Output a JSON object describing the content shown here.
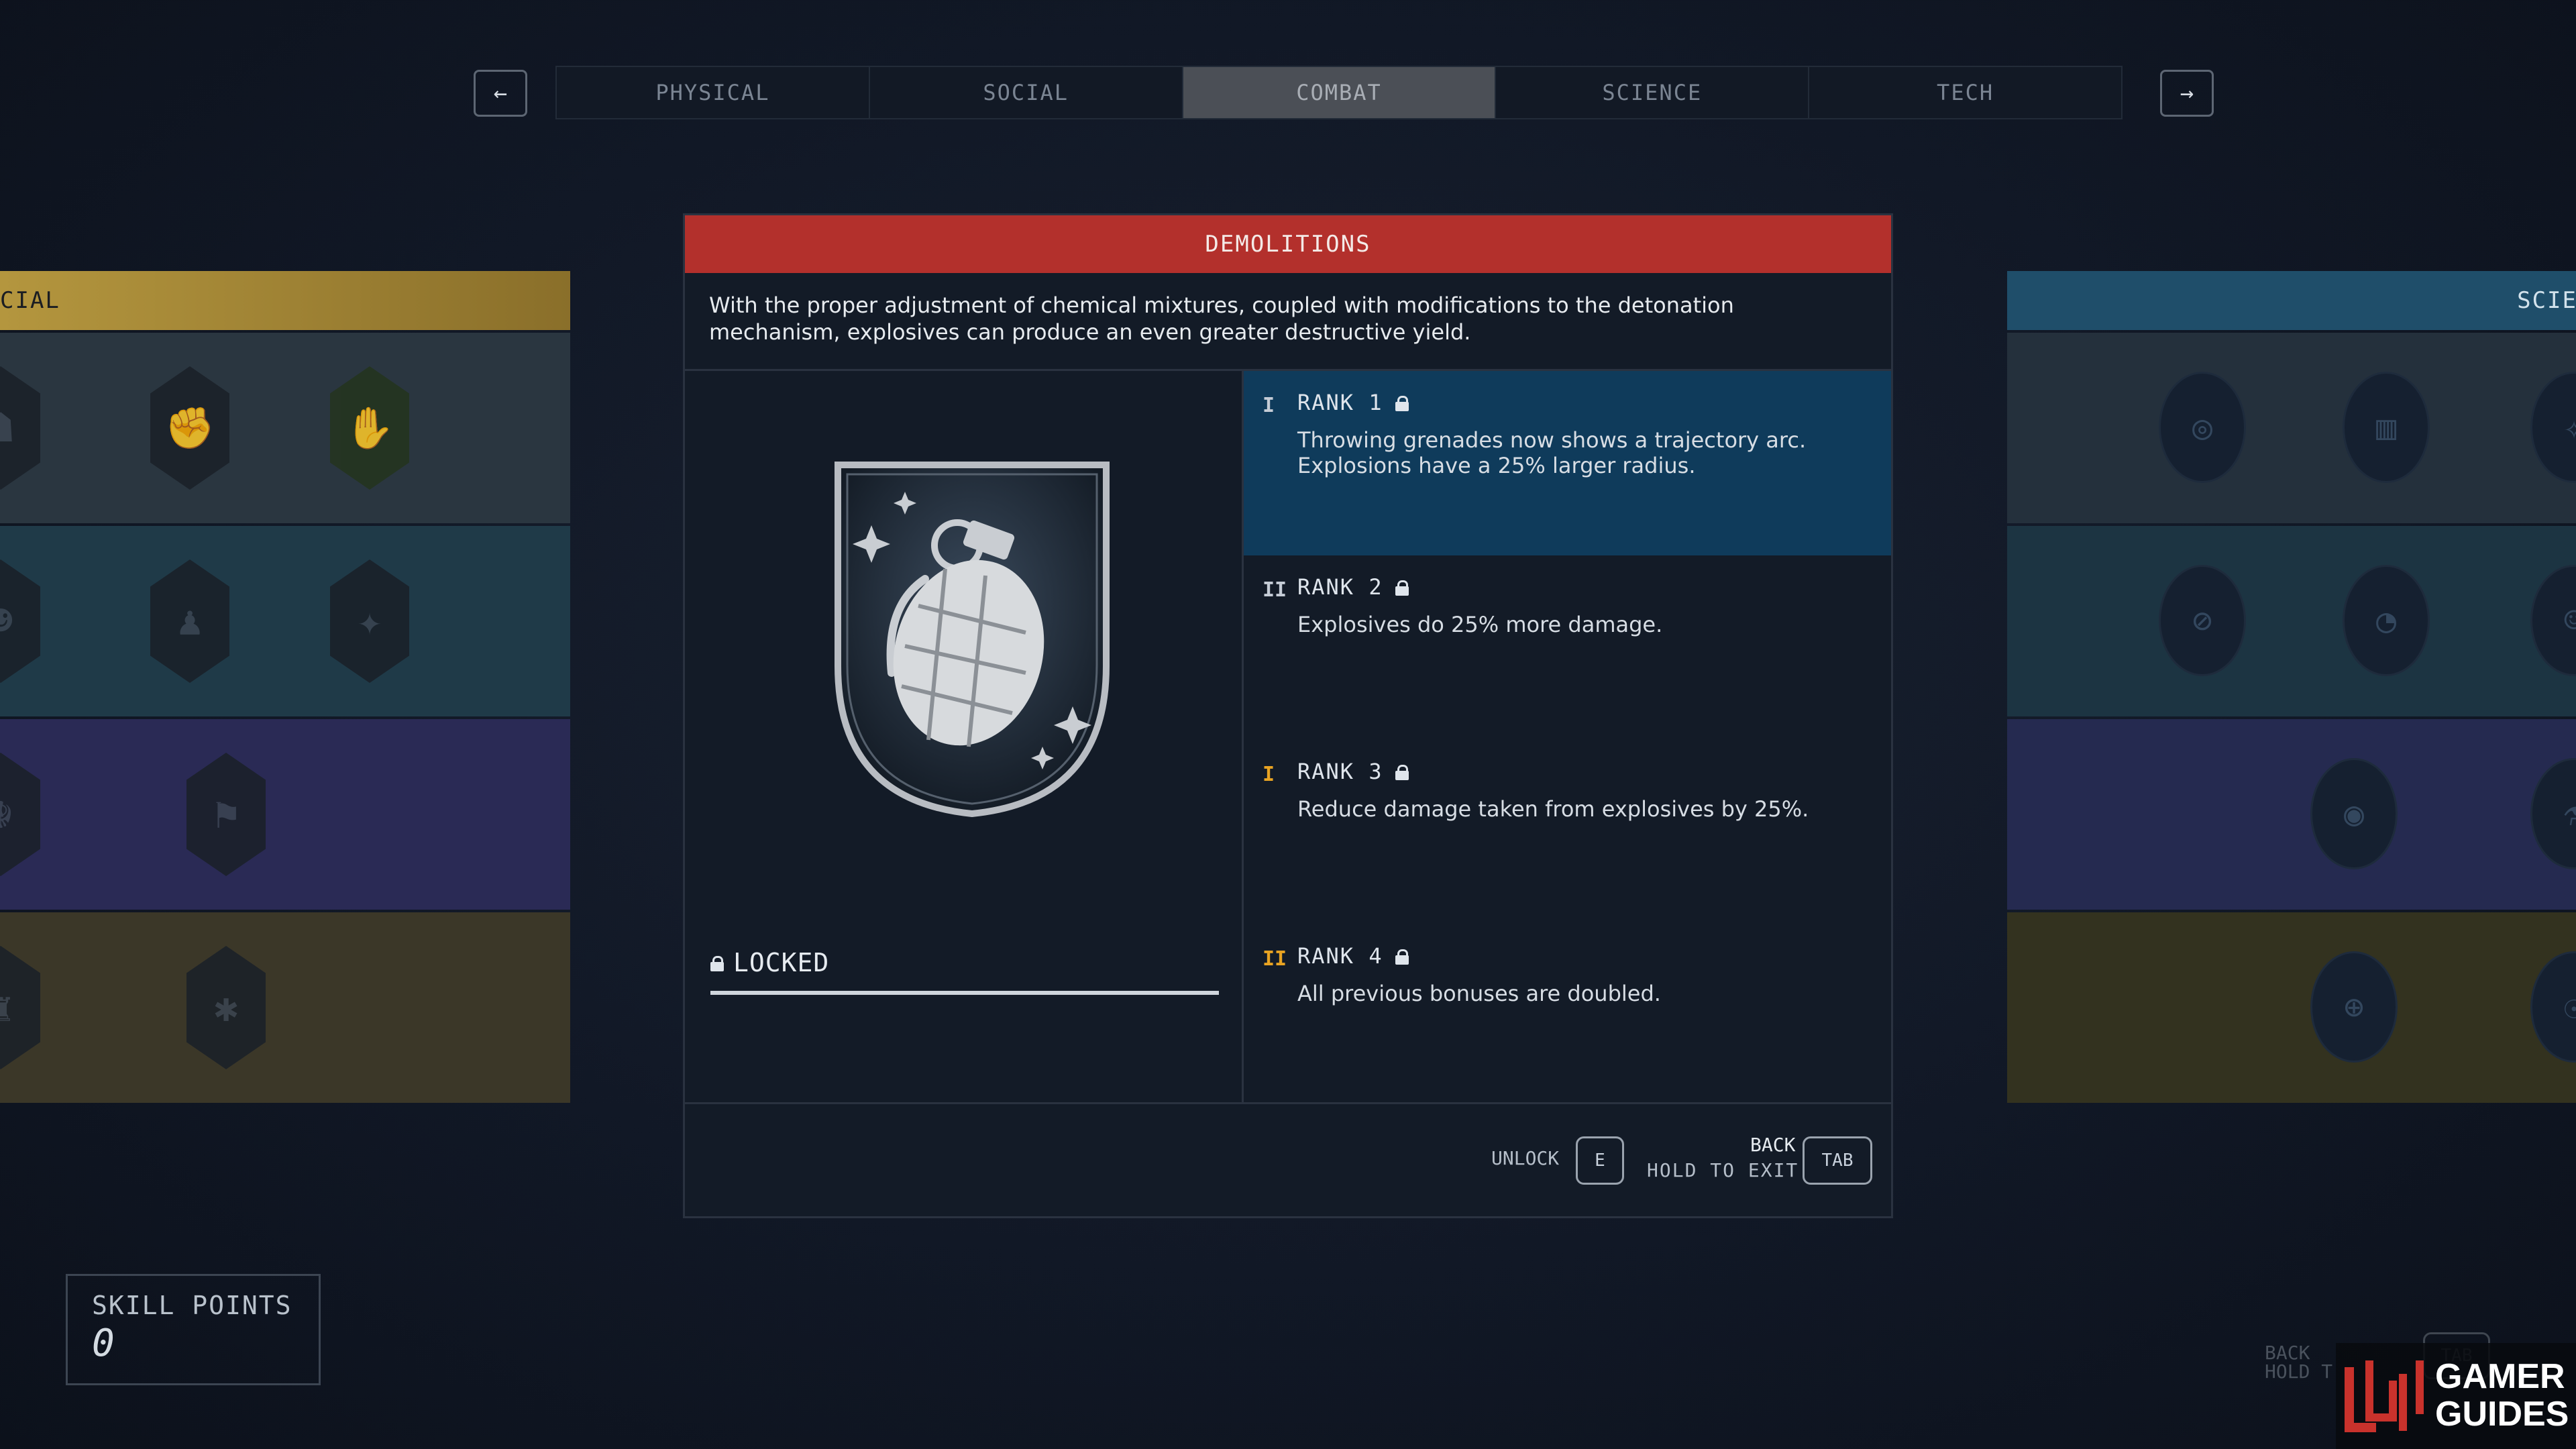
{
  "nav": {
    "prev_icon": "arrow-left-icon",
    "prev_glyph": "←",
    "next_icon": "arrow-right-icon",
    "next_glyph": "→",
    "tabs": [
      {
        "label": "PHYSICAL",
        "active": false
      },
      {
        "label": "SOCIAL",
        "active": false
      },
      {
        "label": "COMBAT",
        "active": true
      },
      {
        "label": "SCIENCE",
        "active": false
      },
      {
        "label": "TECH",
        "active": false
      }
    ]
  },
  "left_panel": {
    "header": "CIAL",
    "header_color": "#a78a37"
  },
  "right_panel": {
    "header": "SCIE",
    "header_color": "#1f4e6a"
  },
  "skill": {
    "title": "DEMOLITIONS",
    "description": "With the proper adjustment of chemical mixtures, coupled with modifications to the detonation mechanism, explosives can produce an even greater destructive yield.",
    "badge_icon": "grenade-badge-icon",
    "status": "LOCKED",
    "ranks": [
      {
        "title": "RANK 1",
        "description": "Throwing grenades now shows a trajectory arc. Explosions have a 25% larger radius.",
        "mark": "I",
        "mark_color": "#c5ccd6",
        "active": true
      },
      {
        "title": "RANK 2",
        "description": "Explosives do 25% more damage.",
        "mark": "II",
        "mark_color": "#c5ccd6",
        "active": false
      },
      {
        "title": "RANK 3",
        "description": "Reduce damage taken from explosives by 25%.",
        "mark": "I",
        "mark_color": "#e8a322",
        "active": false
      },
      {
        "title": "RANK 4",
        "description": "All previous bonuses are doubled.",
        "mark": "II",
        "mark_color": "#e8a322",
        "active": false
      }
    ]
  },
  "footer": {
    "unlock_label": "UNLOCK",
    "unlock_key": "E",
    "back_label": "BACK",
    "hold_label": "HOLD TO EXIT",
    "back_key": "TAB"
  },
  "skill_points": {
    "label": "SKILL POINTS",
    "value": "0"
  },
  "watermark": {
    "line1": "GAMER",
    "line2": "GUIDES"
  },
  "bg_hint": {
    "back": "BACK",
    "hold": "HOLD T",
    "key": "TAB"
  },
  "colors": {
    "title_red": "#b3302c",
    "rank_active": "#0f3b5b"
  }
}
